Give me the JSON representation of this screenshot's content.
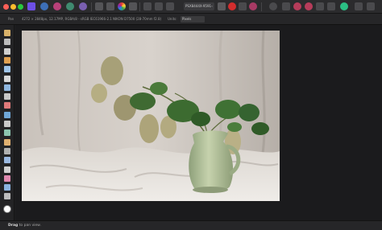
{
  "toolbar": {
    "document_tab": "PSX8444X-9591-4B5...",
    "colors": {
      "close": "#ff5f57",
      "minimize": "#febc2e",
      "zoom": "#28c840",
      "persona": "#6d4fe6",
      "accent": "#0a84ff"
    }
  },
  "context": {
    "label": "Pan",
    "image_info": "4272 × 2848px, 12.17MP, RGBA/8 - sRGB IEC61966-2.1",
    "camera_info": "NIKON D7500 (28-70mm f2.8)",
    "units_label": "Units:",
    "units_value": "Pixels"
  },
  "tools": [
    {
      "name": "hand-tool-icon"
    },
    {
      "name": "view-tool-icon"
    },
    {
      "name": "move-tool-icon"
    },
    {
      "name": "color-picker-icon"
    },
    {
      "name": "crop-tool-icon"
    },
    {
      "name": "selection-brush-icon"
    },
    {
      "name": "flood-select-icon"
    },
    {
      "name": "marquee-icon"
    },
    {
      "name": "paint-brush-icon"
    },
    {
      "name": "fill-tool-icon"
    },
    {
      "name": "erase-brush-icon"
    },
    {
      "name": "dodge-brush-icon"
    },
    {
      "name": "clone-brush-icon"
    },
    {
      "name": "blemish-icon"
    },
    {
      "name": "pen-tool-icon"
    },
    {
      "name": "frame-text-icon"
    },
    {
      "name": "gradient-tool-icon"
    },
    {
      "name": "shape-tool-icon"
    },
    {
      "name": "zoom-tool-icon"
    }
  ],
  "status": {
    "action": "Drag",
    "message": "to pan view."
  }
}
